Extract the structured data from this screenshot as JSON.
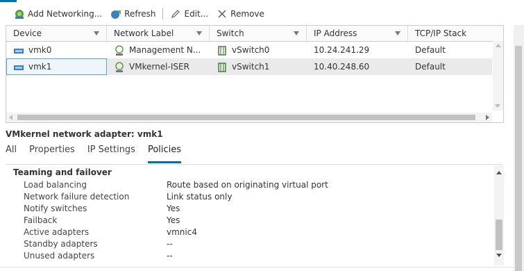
{
  "toolbar": {
    "add_label": "Add Networking...",
    "refresh_label": "Refresh",
    "edit_label": "Edit...",
    "remove_label": "Remove"
  },
  "grid": {
    "columns": [
      "Device",
      "Network Label",
      "Switch",
      "IP Address",
      "TCP/IP Stack"
    ],
    "rows": [
      {
        "device": "vmk0",
        "label": "Management N...",
        "switch": "vSwitch0",
        "ip": "10.24.241.29",
        "stack": "Default"
      },
      {
        "device": "vmk1",
        "label": "VMkernel-ISER",
        "switch": "vSwitch1",
        "ip": "10.40.248.60",
        "stack": "Default"
      }
    ],
    "selected_row": 1
  },
  "detail": {
    "title": "VMkernel network adapter: vmk1",
    "tabs": [
      "All",
      "Properties",
      "IP Settings",
      "Policies"
    ],
    "active_tab": "Policies",
    "section": "Teaming and failover",
    "policies": [
      {
        "key": "Load balancing",
        "value": "Route based on originating virtual port"
      },
      {
        "key": "Network failure detection",
        "value": "Link status only"
      },
      {
        "key": "Notify switches",
        "value": "Yes"
      },
      {
        "key": "Failback",
        "value": "Yes"
      },
      {
        "key": "Active adapters",
        "value": "vmnic4"
      },
      {
        "key": "Standby adapters",
        "value": "--"
      },
      {
        "key": "Unused adapters",
        "value": "--"
      }
    ]
  },
  "colors": {
    "accent": "#0072a3",
    "selected_row": "#eaeaea"
  }
}
